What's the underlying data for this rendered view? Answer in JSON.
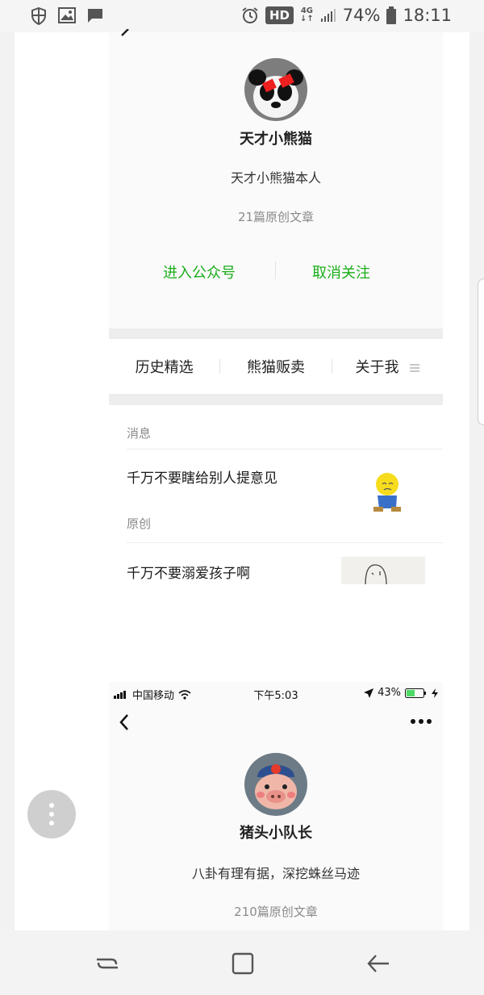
{
  "android_status": {
    "hd": "HD",
    "network_top": "4G",
    "network_bottom": "↓↑",
    "battery": "74%",
    "time": "18:11"
  },
  "profile1": {
    "name": "天才小熊猫",
    "bio": "天才小熊猫本人",
    "articles": "21篇原创文章",
    "enter_label": "进入公众号",
    "unfollow_label": "取消关注"
  },
  "tabs": [
    "历史精选",
    "熊猫贩卖",
    "关于我"
  ],
  "feed": {
    "section1": "消息",
    "article1": "千万不要瞎给别人提意见",
    "section2": "原创",
    "article2": "千万不要溺爱孩子啊"
  },
  "ios_status": {
    "carrier": "中国移动",
    "time": "下午5:03",
    "battery": "43%"
  },
  "profile2": {
    "name": "猪头小队长",
    "bio": "八卦有理有据，深挖蛛丝马迹",
    "articles": "210篇原创文章"
  },
  "icons": {
    "status_left": [
      "shield-icon",
      "image-icon",
      "chat-icon"
    ],
    "status_right": [
      "alarm-icon",
      "signal-icon",
      "battery-icon"
    ],
    "nav": [
      "recent-apps-icon",
      "home-icon",
      "back-icon"
    ]
  },
  "colors": {
    "accent_green": "#1aad19",
    "ios_battery_green": "#4cd964"
  }
}
